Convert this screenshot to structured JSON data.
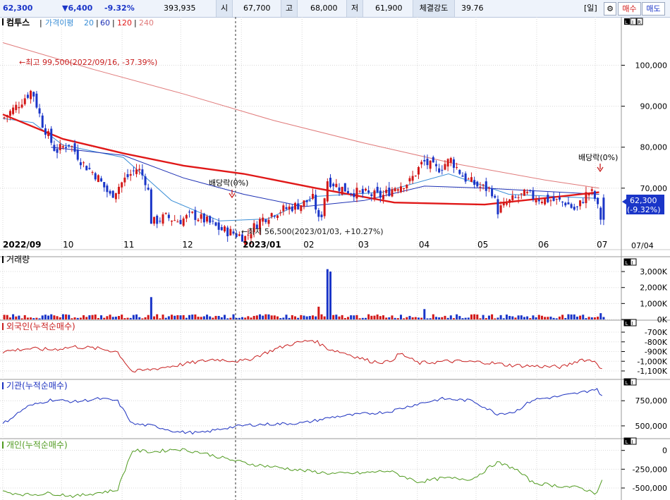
{
  "quote": {
    "price": "62,300",
    "change": "▼6,400",
    "change_pct": "-9.32%",
    "volume": "393,935",
    "open_label": "시",
    "open": "67,700",
    "high_label": "고",
    "high": "68,000",
    "low_label": "저",
    "low": "61,900",
    "strength_label": "체결강도",
    "strength": "39.76",
    "period_button": "[일]",
    "buy_button": "매수",
    "sell_button": "매도",
    "settings_icon": "gear-icon"
  },
  "price_panel": {
    "stock_name": "컴투스",
    "ma_title": "가격이평",
    "ma_periods": [
      "20",
      "60",
      "120",
      "240"
    ],
    "ma_colors": [
      "#3a8ed6",
      "#1c2fb4",
      "#e01818",
      "#e07a7a"
    ],
    "panel_buttons": [
      "L",
      "I",
      "R"
    ],
    "annotation_high": "←최고 99,500(2022/09/16, -37.39%)",
    "annotation_low": "←최저 56,500(2023/01/03, +10.27%)",
    "dividend_label_1": "배당락(0%)",
    "dividend_label_2": "배당락(0%)",
    "current_price_label": "62,300",
    "current_change_label": "(-9.32%)",
    "date_label": "07/04"
  },
  "x_axis_labels": [
    "2022/09",
    "10",
    "11",
    "12",
    "2023/01",
    "02",
    "03",
    "04",
    "05",
    "06",
    "07"
  ],
  "volume_panel": {
    "title": "거래량",
    "buttons": [
      "L",
      "I"
    ]
  },
  "foreign_panel": {
    "title": "외국인(누적순매수)",
    "buttons": [
      "L",
      "I"
    ]
  },
  "inst_panel": {
    "title": "기관(누적순매수)",
    "buttons": [
      "L",
      "I"
    ]
  },
  "retail_panel": {
    "title": "개인(누적순매수)",
    "buttons": [
      "L",
      "I"
    ]
  },
  "colors": {
    "up": "#d21818",
    "down": "#1a35c8",
    "foreign": "#c81e1e",
    "inst": "#1a2fbf",
    "retail": "#4f9a1e",
    "grid": "#d8d8d8"
  },
  "chart_data": [
    {
      "type": "candlestick",
      "title": "컴투스",
      "x_range": [
        "2022/09",
        "2023/07/04"
      ],
      "x_ticks": [
        "2022/09",
        "10",
        "11",
        "12",
        "2023/01",
        "02",
        "03",
        "04",
        "05",
        "06",
        "07"
      ],
      "y_ticks": [
        "100,000",
        "90,000",
        "80,000",
        "70,000"
      ],
      "ylim": [
        55000,
        108000
      ],
      "last_close": 62300,
      "high_point": {
        "value": 99500,
        "date": "2022/09/16"
      },
      "low_point": {
        "value": 56500,
        "date": "2023/01/03"
      },
      "close_profile": [
        [
          "2022/09/01",
          87000
        ],
        [
          "2022/09/08",
          90000
        ],
        [
          "2022/09/16",
          94000
        ],
        [
          "2022/09/21",
          86000
        ],
        [
          "2022/09/28",
          79000
        ],
        [
          "2022/10/05",
          81000
        ],
        [
          "2022/10/12",
          76000
        ],
        [
          "2022/10/19",
          73000
        ],
        [
          "2022/10/26",
          68000
        ],
        [
          "2022/11/02",
          72000
        ],
        [
          "2022/11/09",
          75000
        ],
        [
          "2022/11/14",
          71000
        ],
        [
          "2022/11/16",
          61500
        ],
        [
          "2022/11/23",
          63000
        ],
        [
          "2022/11/30",
          62000
        ],
        [
          "2022/12/07",
          63500
        ],
        [
          "2022/12/14",
          62000
        ],
        [
          "2022/12/21",
          60000
        ],
        [
          "2022/12/28",
          59000
        ],
        [
          "2023/01/03",
          58000
        ],
        [
          "2023/01/10",
          62000
        ],
        [
          "2023/01/17",
          64000
        ],
        [
          "2023/01/31",
          66000
        ],
        [
          "2023/02/07",
          67500
        ],
        [
          "2023/02/10",
          61000
        ],
        [
          "2023/02/14",
          72000
        ],
        [
          "2023/02/21",
          70000
        ],
        [
          "2023/02/28",
          69000
        ],
        [
          "2023/03/07",
          68500
        ],
        [
          "2023/03/14",
          68000
        ],
        [
          "2023/03/21",
          70500
        ],
        [
          "2023/03/28",
          71500
        ],
        [
          "2023/04/04",
          76500
        ],
        [
          "2023/04/11",
          74500
        ],
        [
          "2023/04/18",
          77000
        ],
        [
          "2023/04/25",
          72500
        ],
        [
          "2023/05/02",
          70500
        ],
        [
          "2023/05/09",
          69500
        ],
        [
          "2023/05/12",
          64500
        ],
        [
          "2023/05/19",
          67000
        ],
        [
          "2023/05/26",
          68500
        ],
        [
          "2023/06/02",
          67500
        ],
        [
          "2023/06/09",
          67000
        ],
        [
          "2023/06/16",
          66500
        ],
        [
          "2023/06/21",
          64500
        ],
        [
          "2023/06/27",
          69000
        ],
        [
          "2023/06/30",
          68700
        ],
        [
          "2023/07/04",
          62300
        ]
      ],
      "moving_averages": [
        {
          "name": "20",
          "values": [
            [
              0.0,
              87000
            ],
            [
              0.05,
              86000
            ],
            [
              0.1,
              80500
            ],
            [
              0.2,
              77500
            ],
            [
              0.28,
              67000
            ],
            [
              0.36,
              62000
            ],
            [
              0.44,
              62500
            ],
            [
              0.52,
              68000
            ],
            [
              0.63,
              69000
            ],
            [
              0.74,
              73500
            ],
            [
              0.84,
              68500
            ],
            [
              0.99,
              67500
            ]
          ]
        },
        {
          "name": "60",
          "values": [
            [
              0.08,
              80000
            ],
            [
              0.2,
              78000
            ],
            [
              0.3,
              72500
            ],
            [
              0.4,
              68500
            ],
            [
              0.5,
              65500
            ],
            [
              0.6,
              67000
            ],
            [
              0.7,
              70500
            ],
            [
              0.8,
              70000
            ],
            [
              0.99,
              68500
            ]
          ]
        },
        {
          "name": "120",
          "values": [
            [
              0.0,
              88000
            ],
            [
              0.1,
              82000
            ],
            [
              0.2,
              78500
            ],
            [
              0.3,
              75500
            ],
            [
              0.4,
              73500
            ],
            [
              0.52,
              70000
            ],
            [
              0.65,
              66500
            ],
            [
              0.8,
              66000
            ],
            [
              0.99,
              69000
            ]
          ]
        },
        {
          "name": "240",
          "values": [
            [
              0.0,
              105500
            ],
            [
              0.15,
              99000
            ],
            [
              0.3,
              93000
            ],
            [
              0.45,
              86500
            ],
            [
              0.6,
              81000
            ],
            [
              0.75,
              76000
            ],
            [
              0.9,
              72000
            ],
            [
              0.99,
              70000
            ]
          ]
        }
      ]
    },
    {
      "type": "bar",
      "title": "거래량",
      "y_ticks": [
        "3,000K",
        "2,000K",
        "1,000K",
        "0K"
      ],
      "ylim": [
        0,
        3400
      ],
      "unit": "K",
      "spikes": [
        [
          "2022/11/16",
          1400
        ],
        [
          "2023/02/14",
          3150
        ],
        [
          "2023/02/15",
          3000
        ],
        [
          "2023/02/10",
          800
        ],
        [
          "2023/04/04",
          650
        ],
        [
          "2023/07/04",
          394
        ]
      ],
      "typical": 220
    },
    {
      "type": "line",
      "title": "외국인(누적순매수)",
      "y_ticks": [
        "-700K",
        "-800K",
        "-900K",
        "-1,000K",
        "-1,100K"
      ],
      "ylim": [
        -1180,
        -620
      ],
      "values": [
        [
          0.0,
          -900
        ],
        [
          0.04,
          -870
        ],
        [
          0.08,
          -880
        ],
        [
          0.12,
          -850
        ],
        [
          0.16,
          -870
        ],
        [
          0.19,
          -900
        ],
        [
          0.215,
          -1110
        ],
        [
          0.25,
          -1080
        ],
        [
          0.3,
          -1030
        ],
        [
          0.35,
          -980
        ],
        [
          0.4,
          -1000
        ],
        [
          0.45,
          -880
        ],
        [
          0.48,
          -820
        ],
        [
          0.515,
          -780
        ],
        [
          0.54,
          -870
        ],
        [
          0.57,
          -920
        ],
        [
          0.61,
          -1000
        ],
        [
          0.64,
          -1010
        ],
        [
          0.66,
          -920
        ],
        [
          0.69,
          -1020
        ],
        [
          0.74,
          -1000
        ],
        [
          0.8,
          -1010
        ],
        [
          0.84,
          -1040
        ],
        [
          0.88,
          -1050
        ],
        [
          0.93,
          -1060
        ],
        [
          0.96,
          -980
        ],
        [
          0.985,
          -1000
        ],
        [
          0.995,
          -1090
        ]
      ]
    },
    {
      "type": "line",
      "title": "기관(누적순매수)",
      "y_ticks": [
        "750,000",
        "500,000"
      ],
      "ylim": [
        380000,
        920000
      ],
      "values": [
        [
          0.0,
          520000
        ],
        [
          0.04,
          690000
        ],
        [
          0.08,
          760000
        ],
        [
          0.12,
          740000
        ],
        [
          0.16,
          770000
        ],
        [
          0.19,
          750000
        ],
        [
          0.215,
          520000
        ],
        [
          0.25,
          500000
        ],
        [
          0.29,
          440000
        ],
        [
          0.33,
          430000
        ],
        [
          0.37,
          480000
        ],
        [
          0.41,
          510000
        ],
        [
          0.46,
          520000
        ],
        [
          0.5,
          530000
        ],
        [
          0.55,
          590000
        ],
        [
          0.6,
          620000
        ],
        [
          0.64,
          640000
        ],
        [
          0.69,
          720000
        ],
        [
          0.73,
          770000
        ],
        [
          0.78,
          750000
        ],
        [
          0.82,
          620000
        ],
        [
          0.85,
          640000
        ],
        [
          0.88,
          760000
        ],
        [
          0.92,
          790000
        ],
        [
          0.96,
          830000
        ],
        [
          0.985,
          870000
        ],
        [
          0.995,
          800000
        ]
      ]
    },
    {
      "type": "line",
      "title": "개인(누적순매수)",
      "y_ticks": [
        "0",
        "-250,000",
        "-500,000"
      ],
      "ylim": [
        -650000,
        100000
      ],
      "values": [
        [
          0.0,
          -550000
        ],
        [
          0.04,
          -590000
        ],
        [
          0.08,
          -570000
        ],
        [
          0.12,
          -610000
        ],
        [
          0.16,
          -560000
        ],
        [
          0.19,
          -530000
        ],
        [
          0.215,
          0
        ],
        [
          0.25,
          -20000
        ],
        [
          0.29,
          20000
        ],
        [
          0.33,
          -30000
        ],
        [
          0.37,
          -110000
        ],
        [
          0.41,
          -180000
        ],
        [
          0.46,
          -230000
        ],
        [
          0.5,
          -270000
        ],
        [
          0.55,
          -310000
        ],
        [
          0.6,
          -300000
        ],
        [
          0.64,
          -270000
        ],
        [
          0.69,
          -420000
        ],
        [
          0.73,
          -370000
        ],
        [
          0.78,
          -380000
        ],
        [
          0.82,
          -160000
        ],
        [
          0.85,
          -240000
        ],
        [
          0.88,
          -430000
        ],
        [
          0.92,
          -470000
        ],
        [
          0.96,
          -500000
        ],
        [
          0.985,
          -570000
        ],
        [
          0.995,
          -400000
        ]
      ]
    }
  ]
}
